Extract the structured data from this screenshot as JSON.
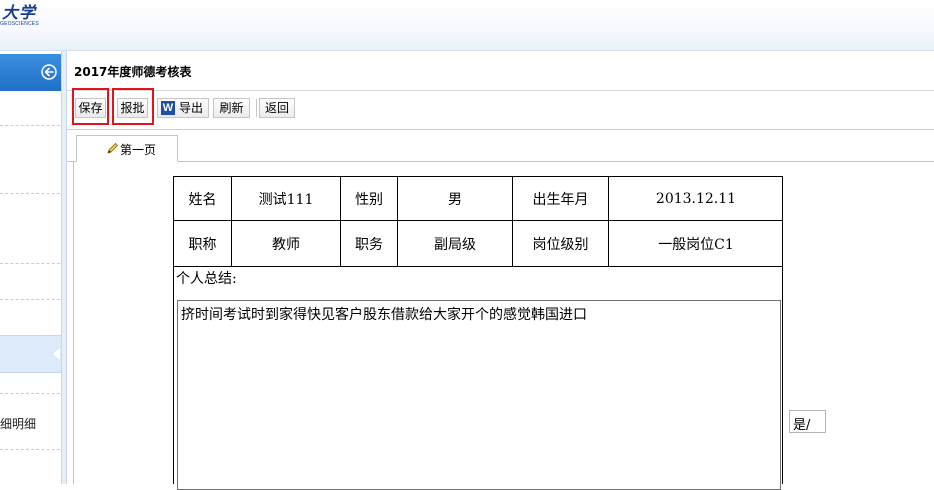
{
  "header": {
    "logo_text": "大学",
    "logo_sub": "GEOSCIENCES"
  },
  "sidebar": {
    "collapse_icon": "arrow-left-circle-icon",
    "item_label": "细明细"
  },
  "main": {
    "title": "2017年度师德考核表"
  },
  "toolbar": {
    "save_label": "保存",
    "submit_label": "报批",
    "export_icon": "word-icon",
    "word_icon_letter": "W",
    "export_label": "导出",
    "refresh_label": "刷新",
    "back_label": "返回"
  },
  "tabs": [
    {
      "label": "第一页",
      "icon": "pencil-icon"
    }
  ],
  "form": {
    "name_label": "姓名",
    "name_value": "测试111",
    "gender_label": "性别",
    "gender_value": "男",
    "birth_label": "出生年月",
    "birth_value": "2013.12.11",
    "title_label": "职称",
    "title_value": "教师",
    "duty_label": "职务",
    "duty_value": "副局级",
    "level_label": "岗位级别",
    "level_value": "一般岗位C1",
    "summary_label": "个人总结:",
    "summary_text": "挤时间考试时到家得快见客户股东借款给大家开个的感觉韩国进口"
  },
  "side_field": {
    "value": "是/"
  },
  "colors": {
    "sidebar_header": "#2f82d8",
    "highlight_border": "#e0141e",
    "word_icon": "#1c4fa8"
  }
}
